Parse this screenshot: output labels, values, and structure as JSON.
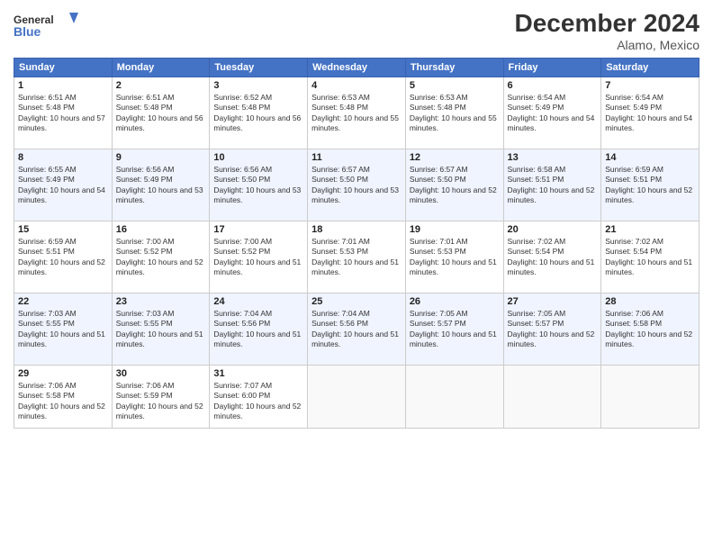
{
  "header": {
    "logo_line1": "General",
    "logo_line2": "Blue",
    "month": "December 2024",
    "location": "Alamo, Mexico"
  },
  "weekdays": [
    "Sunday",
    "Monday",
    "Tuesday",
    "Wednesday",
    "Thursday",
    "Friday",
    "Saturday"
  ],
  "weeks": [
    [
      {
        "day": "1",
        "sunrise": "6:51 AM",
        "sunset": "5:48 PM",
        "daylight": "10 hours and 57 minutes."
      },
      {
        "day": "2",
        "sunrise": "6:51 AM",
        "sunset": "5:48 PM",
        "daylight": "10 hours and 56 minutes."
      },
      {
        "day": "3",
        "sunrise": "6:52 AM",
        "sunset": "5:48 PM",
        "daylight": "10 hours and 56 minutes."
      },
      {
        "day": "4",
        "sunrise": "6:53 AM",
        "sunset": "5:48 PM",
        "daylight": "10 hours and 55 minutes."
      },
      {
        "day": "5",
        "sunrise": "6:53 AM",
        "sunset": "5:48 PM",
        "daylight": "10 hours and 55 minutes."
      },
      {
        "day": "6",
        "sunrise": "6:54 AM",
        "sunset": "5:49 PM",
        "daylight": "10 hours and 54 minutes."
      },
      {
        "day": "7",
        "sunrise": "6:54 AM",
        "sunset": "5:49 PM",
        "daylight": "10 hours and 54 minutes."
      }
    ],
    [
      {
        "day": "8",
        "sunrise": "6:55 AM",
        "sunset": "5:49 PM",
        "daylight": "10 hours and 54 minutes."
      },
      {
        "day": "9",
        "sunrise": "6:56 AM",
        "sunset": "5:49 PM",
        "daylight": "10 hours and 53 minutes."
      },
      {
        "day": "10",
        "sunrise": "6:56 AM",
        "sunset": "5:50 PM",
        "daylight": "10 hours and 53 minutes."
      },
      {
        "day": "11",
        "sunrise": "6:57 AM",
        "sunset": "5:50 PM",
        "daylight": "10 hours and 53 minutes."
      },
      {
        "day": "12",
        "sunrise": "6:57 AM",
        "sunset": "5:50 PM",
        "daylight": "10 hours and 52 minutes."
      },
      {
        "day": "13",
        "sunrise": "6:58 AM",
        "sunset": "5:51 PM",
        "daylight": "10 hours and 52 minutes."
      },
      {
        "day": "14",
        "sunrise": "6:59 AM",
        "sunset": "5:51 PM",
        "daylight": "10 hours and 52 minutes."
      }
    ],
    [
      {
        "day": "15",
        "sunrise": "6:59 AM",
        "sunset": "5:51 PM",
        "daylight": "10 hours and 52 minutes."
      },
      {
        "day": "16",
        "sunrise": "7:00 AM",
        "sunset": "5:52 PM",
        "daylight": "10 hours and 52 minutes."
      },
      {
        "day": "17",
        "sunrise": "7:00 AM",
        "sunset": "5:52 PM",
        "daylight": "10 hours and 51 minutes."
      },
      {
        "day": "18",
        "sunrise": "7:01 AM",
        "sunset": "5:53 PM",
        "daylight": "10 hours and 51 minutes."
      },
      {
        "day": "19",
        "sunrise": "7:01 AM",
        "sunset": "5:53 PM",
        "daylight": "10 hours and 51 minutes."
      },
      {
        "day": "20",
        "sunrise": "7:02 AM",
        "sunset": "5:54 PM",
        "daylight": "10 hours and 51 minutes."
      },
      {
        "day": "21",
        "sunrise": "7:02 AM",
        "sunset": "5:54 PM",
        "daylight": "10 hours and 51 minutes."
      }
    ],
    [
      {
        "day": "22",
        "sunrise": "7:03 AM",
        "sunset": "5:55 PM",
        "daylight": "10 hours and 51 minutes."
      },
      {
        "day": "23",
        "sunrise": "7:03 AM",
        "sunset": "5:55 PM",
        "daylight": "10 hours and 51 minutes."
      },
      {
        "day": "24",
        "sunrise": "7:04 AM",
        "sunset": "5:56 PM",
        "daylight": "10 hours and 51 minutes."
      },
      {
        "day": "25",
        "sunrise": "7:04 AM",
        "sunset": "5:56 PM",
        "daylight": "10 hours and 51 minutes."
      },
      {
        "day": "26",
        "sunrise": "7:05 AM",
        "sunset": "5:57 PM",
        "daylight": "10 hours and 51 minutes."
      },
      {
        "day": "27",
        "sunrise": "7:05 AM",
        "sunset": "5:57 PM",
        "daylight": "10 hours and 52 minutes."
      },
      {
        "day": "28",
        "sunrise": "7:06 AM",
        "sunset": "5:58 PM",
        "daylight": "10 hours and 52 minutes."
      }
    ],
    [
      {
        "day": "29",
        "sunrise": "7:06 AM",
        "sunset": "5:58 PM",
        "daylight": "10 hours and 52 minutes."
      },
      {
        "day": "30",
        "sunrise": "7:06 AM",
        "sunset": "5:59 PM",
        "daylight": "10 hours and 52 minutes."
      },
      {
        "day": "31",
        "sunrise": "7:07 AM",
        "sunset": "6:00 PM",
        "daylight": "10 hours and 52 minutes."
      },
      null,
      null,
      null,
      null
    ]
  ]
}
